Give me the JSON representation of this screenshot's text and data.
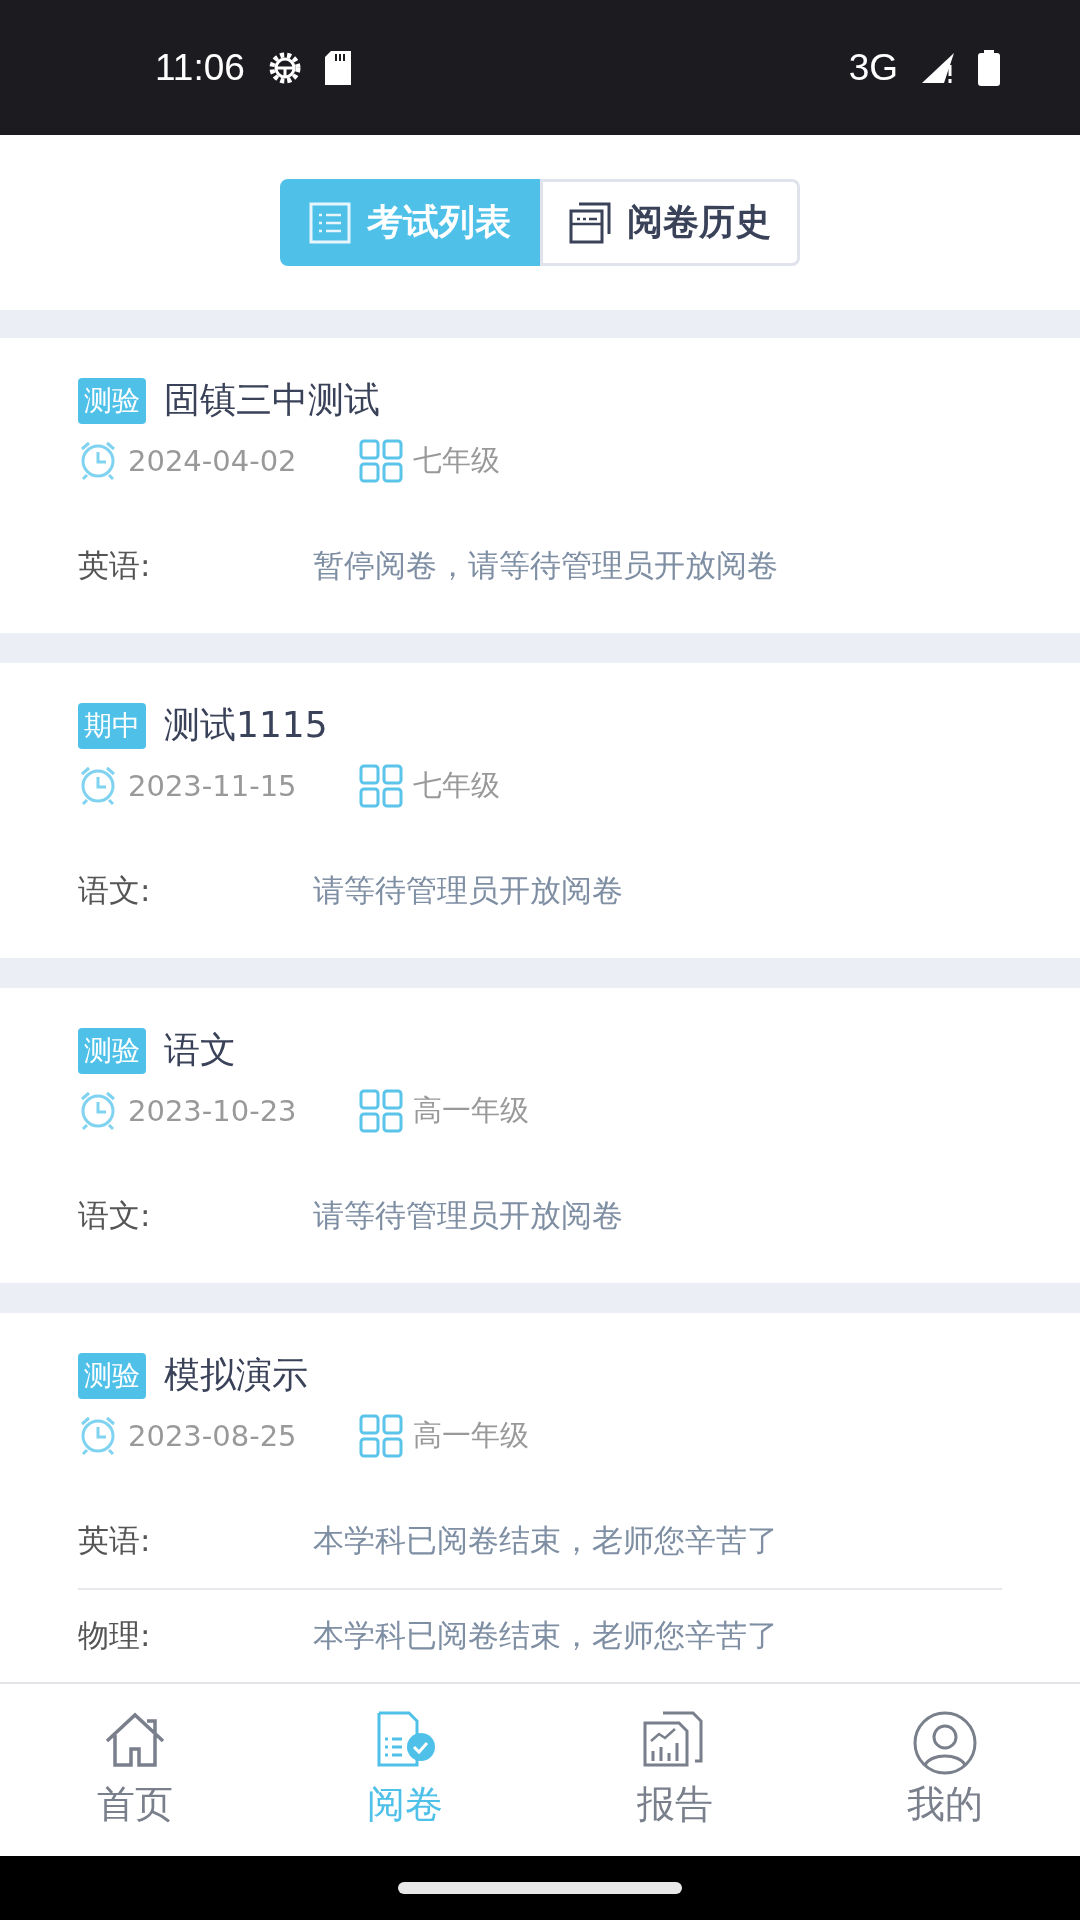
{
  "status_bar": {
    "time": "11:06",
    "network": "3G"
  },
  "tabs": [
    {
      "label": "考试列表",
      "kind": "list",
      "selected": true
    },
    {
      "label": "阅卷历史",
      "kind": "history",
      "selected": false
    }
  ],
  "exams": [
    {
      "tag": "测验",
      "title": "固镇三中测试",
      "date": "2024-04-02",
      "grade": "七年级",
      "subjects": [
        {
          "subject": "英语:",
          "status": "暂停阅卷，请等待管理员开放阅卷"
        }
      ]
    },
    {
      "tag": "期中",
      "title": "测试1115",
      "date": "2023-11-15",
      "grade": "七年级",
      "subjects": [
        {
          "subject": "语文:",
          "status": "请等待管理员开放阅卷"
        }
      ]
    },
    {
      "tag": "测验",
      "title": "语文",
      "date": "2023-10-23",
      "grade": "高一年级",
      "subjects": [
        {
          "subject": "语文:",
          "status": "请等待管理员开放阅卷"
        }
      ]
    },
    {
      "tag": "测验",
      "title": "模拟演示",
      "date": "2023-08-25",
      "grade": "高一年级",
      "subjects": [
        {
          "subject": "英语:",
          "status": "本学科已阅卷结束，老师您辛苦了"
        },
        {
          "subject": "物理:",
          "status": "本学科已阅卷结束，老师您辛苦了"
        }
      ]
    }
  ],
  "nav": [
    {
      "label": "首页",
      "kind": "home",
      "selected": false
    },
    {
      "label": "阅卷",
      "kind": "grading",
      "selected": true
    },
    {
      "label": "报告",
      "kind": "report",
      "selected": false
    },
    {
      "label": "我的",
      "kind": "profile",
      "selected": false
    }
  ]
}
